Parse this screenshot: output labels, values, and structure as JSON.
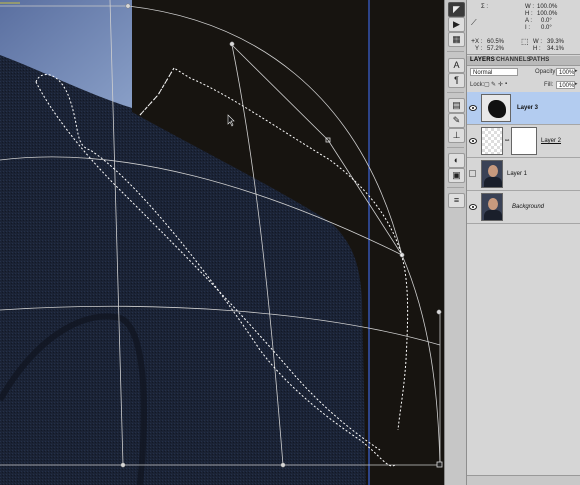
{
  "info_panel": {
    "sigma": "Σ :",
    "w1_label": "W :",
    "w1_value": "100.0%",
    "h1_label": "H :",
    "h1_value": "100.0%",
    "a_label": "A :",
    "a_value": "0.0°",
    "i_label": "I :",
    "i_value": "0.0°",
    "x_label": "X :",
    "x_value": "60.5%",
    "y_label": "Y :",
    "y_value": "57.2%",
    "w2_label": "W :",
    "w2_value": "39.3%",
    "h2_label": "H :",
    "h2_value": "34.1%"
  },
  "panel_tabs": [
    "LAYERS",
    "CHANNELS",
    "PATHS"
  ],
  "blend_mode": "Normal",
  "opacity_label": "Opacity:",
  "opacity_value": "100%",
  "lock_label": "Lock:",
  "fill_label": "Fill:",
  "fill_value": "100%",
  "layers": [
    {
      "name": "Layer 3",
      "visible": true,
      "selected": true,
      "bold": true,
      "italic": false,
      "underline": false
    },
    {
      "name": "Layer 2",
      "visible": true,
      "selected": false,
      "bold": false,
      "italic": false,
      "underline": true
    },
    {
      "name": "Layer 1",
      "visible": false,
      "selected": false,
      "bold": false,
      "italic": false,
      "underline": false
    },
    {
      "name": "Background",
      "visible": true,
      "selected": false,
      "bold": false,
      "italic": true,
      "underline": false
    }
  ],
  "tool_icons": [
    "arrow-icon",
    "play-icon",
    "grid-icon",
    "sigma-icon",
    "pen-measure-icon",
    "text-icon",
    "paragraph-icon",
    "swatch-icon",
    "brush-icon",
    "clone-stamp-icon",
    "circle-half-icon",
    "mask-icon",
    "adjust-icon",
    "layers-stack-icon"
  ],
  "colors": {
    "selection_layer_row": "#b3ccf0",
    "canvas_dark": "#171410",
    "jacket": "#1a2233",
    "sky": "#6f86b4"
  }
}
